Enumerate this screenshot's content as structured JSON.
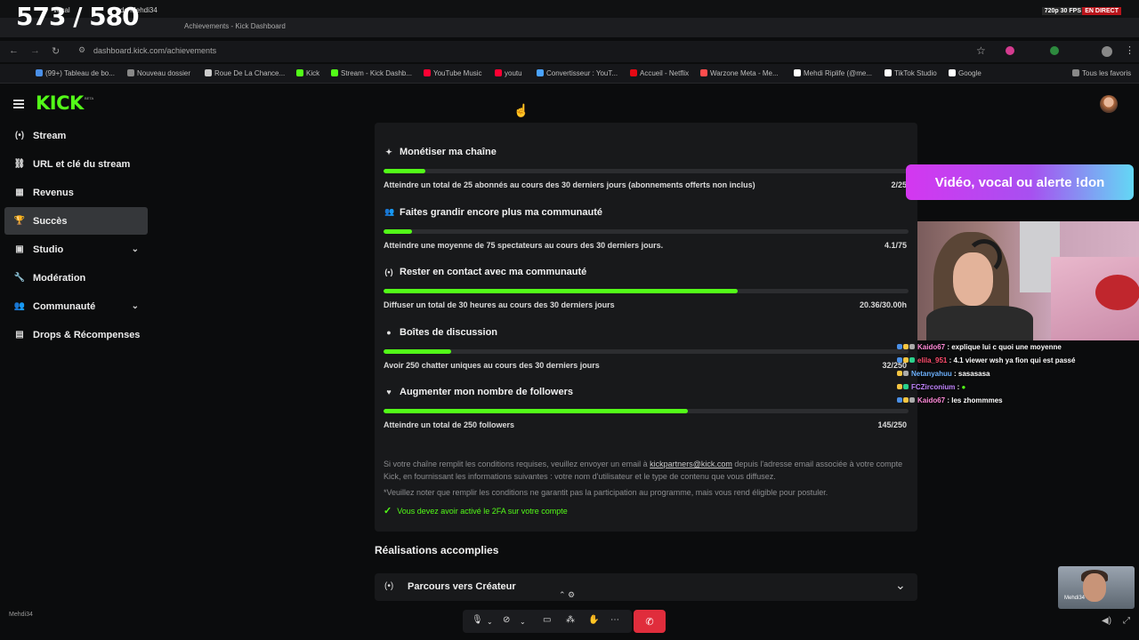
{
  "overlay": {
    "counter": "573 / 580",
    "stream_stats": "720p 30 FPS",
    "live_badge": "EN DIRECT",
    "donation_banner": "Vidéo, vocal ou alerte !don",
    "chat": [
      {
        "user": "Kaido67",
        "user_color": "#ff8ad8",
        "message": "explique lui c quoi une moyenne"
      },
      {
        "user": "elila_951",
        "user_color": "#ff4d6d",
        "message": "4.1 viewer wsh ya fion qui est passé"
      },
      {
        "user": "Netanyahuu",
        "user_color": "#6fb3ff",
        "message": "sasasasa"
      },
      {
        "user": "FCZirconium",
        "user_color": "#c084fc",
        "message": ""
      },
      {
        "user": "Kaido67",
        "user_color": "#ff8ad8",
        "message": "les zhommmes"
      }
    ],
    "pip_name": "Mehdi34",
    "bottom_left_name": "Mehdi34"
  },
  "browser": {
    "tabs": [
      "vocal",
      "de Mehdi34",
      "Achievements - Kick Dashboard"
    ],
    "url": "dashboard.kick.com/achievements",
    "bookmarks": [
      {
        "label": "(99+) Tableau de bo...",
        "color": "#4a8fe7"
      },
      {
        "label": "Nouveau dossier",
        "color": "#888888"
      },
      {
        "label": "Roue De La Chance...",
        "color": "#cccccc"
      },
      {
        "label": "Kick",
        "color": "#53fc18"
      },
      {
        "label": "Stream - Kick Dashb...",
        "color": "#53fc18"
      },
      {
        "label": "YouTube Music",
        "color": "#ff0033"
      },
      {
        "label": "youtu",
        "color": "#ff0033"
      },
      {
        "label": "Convertisseur : YouT...",
        "color": "#4aa3ff"
      },
      {
        "label": "Accueil - Netflix",
        "color": "#e50914"
      },
      {
        "label": "Warzone Meta - Me...",
        "color": "#ff4d4d"
      },
      {
        "label": "Mehdi Riplife (@me...",
        "color": "#ffffff"
      },
      {
        "label": "TikTok Studio",
        "color": "#ffffff"
      },
      {
        "label": "Google",
        "color": "#ffffff"
      }
    ],
    "all_favorites": "Tous les favoris"
  },
  "app": {
    "logo": "KICK",
    "logo_tag": "BETA",
    "sidebar": [
      {
        "label": "Stream",
        "icon": "broadcast-icon",
        "glyph": "(•)",
        "active": false,
        "expand": false
      },
      {
        "label": "URL et clé du stream",
        "icon": "link-icon",
        "glyph": "⛓",
        "active": false,
        "expand": false
      },
      {
        "label": "Revenus",
        "icon": "chart-icon",
        "glyph": "▦",
        "active": false,
        "expand": false
      },
      {
        "label": "Succès",
        "icon": "trophy-icon",
        "glyph": "🏆",
        "active": true,
        "expand": false
      },
      {
        "label": "Studio",
        "icon": "studio-icon",
        "glyph": "▣",
        "active": false,
        "expand": true
      },
      {
        "label": "Modération",
        "icon": "wrench-icon",
        "glyph": "🔧",
        "active": false,
        "expand": false
      },
      {
        "label": "Communauté",
        "icon": "community-icon",
        "glyph": "👥",
        "active": false,
        "expand": true
      },
      {
        "label": "Drops & Récompenses",
        "icon": "gift-icon",
        "glyph": "▤",
        "active": false,
        "expand": false
      }
    ],
    "achievements": [
      {
        "title": "Monétiser ma chaîne",
        "icon": "sparkle-icon",
        "glyph": "✦",
        "desc": "Atteindre un total de 25 abonnés au cours des 30 derniers jours (abonnements offerts non inclus)",
        "value": "2/25",
        "progress": 0.08
      },
      {
        "title": "Faites grandir encore plus ma communauté",
        "icon": "people-icon",
        "glyph": "👥",
        "desc": "Atteindre une moyenne de 75 spectateurs au cours des 30 derniers jours.",
        "value": "4.1/75",
        "progress": 0.055
      },
      {
        "title": "Rester en contact avec ma communauté",
        "icon": "broadcast-icon",
        "glyph": "(•)",
        "desc": "Diffuser un total de 30 heures au cours des 30 derniers jours",
        "value": "20.36/30.00h",
        "progress": 0.675
      },
      {
        "title": "Boîtes de discussion",
        "icon": "chat-bubble-icon",
        "glyph": "●",
        "desc": "Avoir 250 chatter uniques au cours des 30 derniers jours",
        "value": "32/250",
        "progress": 0.128
      },
      {
        "title": "Augmenter mon nombre de followers",
        "icon": "heart-icon",
        "glyph": "♥",
        "desc": "Atteindre un total de 250 followers",
        "value": "145/250",
        "progress": 0.58
      }
    ],
    "notice_part1": "Si votre chaîne remplit les conditions requises, veuillez envoyer un email à",
    "notice_email": "kickpartners@kick.com",
    "notice_part2": "depuis l'adresse email associée à votre compte Kick, en fournissant les informations suivantes : votre nom d'utilisateur et le type de contenu que vous diffusez.",
    "notice_disclaimer": "*Veuillez noter que remplir les conditions ne garantit pas la participation au programme, mais vous rend éligible pour postuler.",
    "twofa": "Vous devez avoir activé le 2FA sur votre compte",
    "completed_title": "Réalisations accomplies",
    "creator_path": "Parcours vers Créateur"
  }
}
